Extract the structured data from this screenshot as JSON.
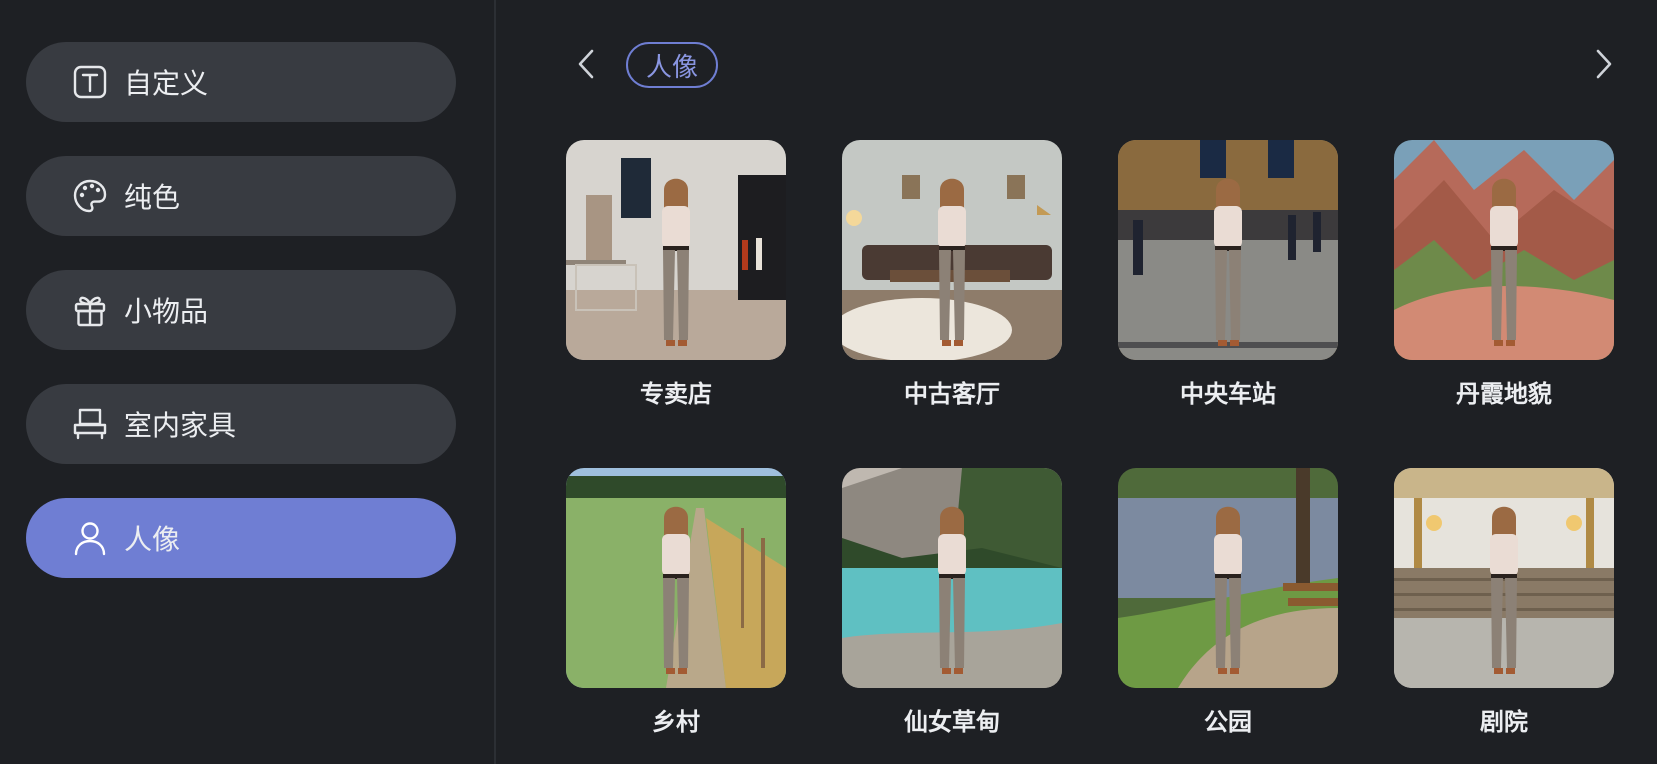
{
  "sidebar": {
    "items": [
      {
        "label": "自定义",
        "icon": "text-box-icon",
        "active": false
      },
      {
        "label": "纯色",
        "icon": "palette-icon",
        "active": false
      },
      {
        "label": "小物品",
        "icon": "gift-icon",
        "active": false
      },
      {
        "label": "室内家具",
        "icon": "furniture-icon",
        "active": false
      },
      {
        "label": "人像",
        "icon": "person-icon",
        "active": true
      }
    ]
  },
  "main": {
    "active_chip": "人像",
    "prev_icon": "chevron-left-icon",
    "next_icon": "chevron-right-icon",
    "scenes": [
      {
        "label": "专卖店"
      },
      {
        "label": "中古客厅"
      },
      {
        "label": "中央车站"
      },
      {
        "label": "丹霞地貌"
      },
      {
        "label": "乡村"
      },
      {
        "label": "仙女草甸"
      },
      {
        "label": "公园"
      },
      {
        "label": "剧院"
      }
    ]
  },
  "colors": {
    "accent": "#6f7ed3",
    "background": "#1e2024",
    "pill": "#383b41"
  }
}
